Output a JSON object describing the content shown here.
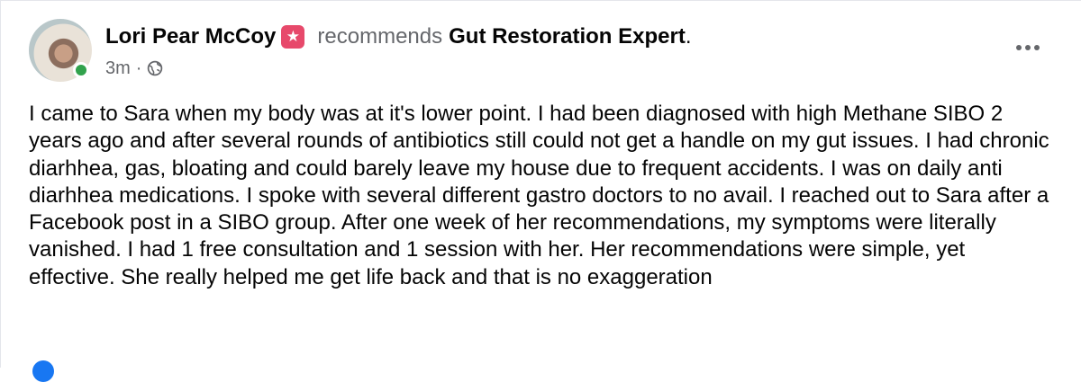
{
  "post": {
    "author": "Lori Pear McCoy",
    "verb": "recommends",
    "target": "Gut Restoration Expert",
    "period": ".",
    "time": "3m",
    "separator": "·",
    "audience_icon": "globe-icon",
    "badge_icon": "star-badge-icon",
    "more_icon": "more-options-icon",
    "text": "I came to Sara when my body was at it's lower point. I had been diagnosed with high Methane SIBO 2 years ago and after several rounds of antibiotics still could not get a handle on my gut issues. I had chronic diarhhea, gas, bloating and could barely leave my house due to frequent accidents. I was on daily anti diarhhea medications. I spoke with several different gastro doctors to no avail. I reached out to Sara after a Facebook post in a SIBO group. After one week of her recommendations, my symptoms were literally vanished. I had 1 free consultation and 1 session with her. Her recommendations were simple, yet effective. She really helped me get life back and that is no exaggeration"
  },
  "colors": {
    "primary_text": "#050505",
    "secondary_text": "#65676b",
    "online": "#31a24c",
    "badge": "#e7496b"
  }
}
